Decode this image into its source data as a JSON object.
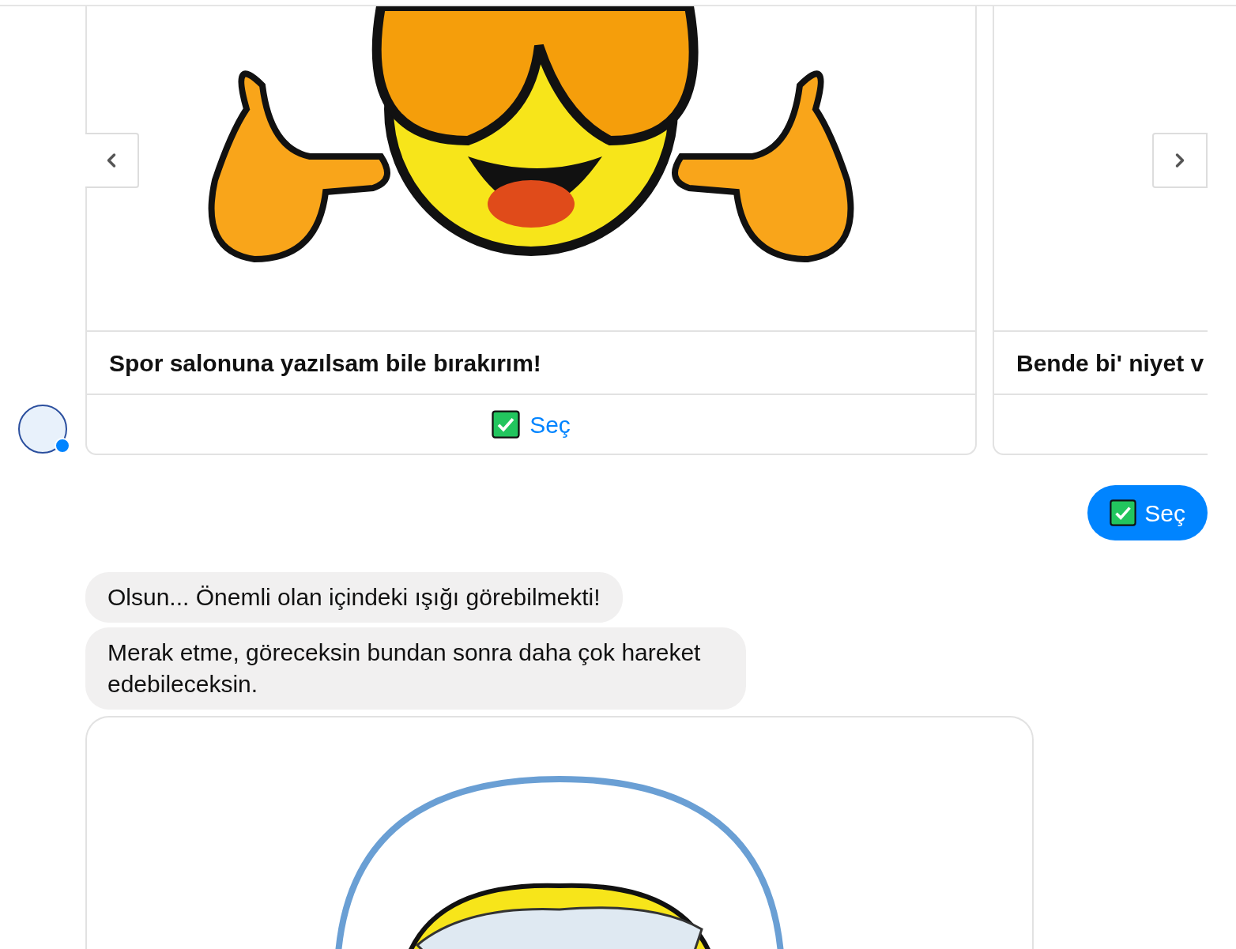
{
  "carousel": {
    "cards": [
      {
        "title": "Spor salonuna yazılsam bile bırakırım!",
        "button": "Seç"
      },
      {
        "title": "Bende bi' niyet v"
      }
    ]
  },
  "reply": {
    "text": "Seç"
  },
  "messages": [
    {
      "text": "Olsun... Önemli olan içindeki ışığı görebilmekti!"
    },
    {
      "text": "Merak etme, göreceksin bundan sonra daha çok hareket edebileceksin."
    }
  ]
}
